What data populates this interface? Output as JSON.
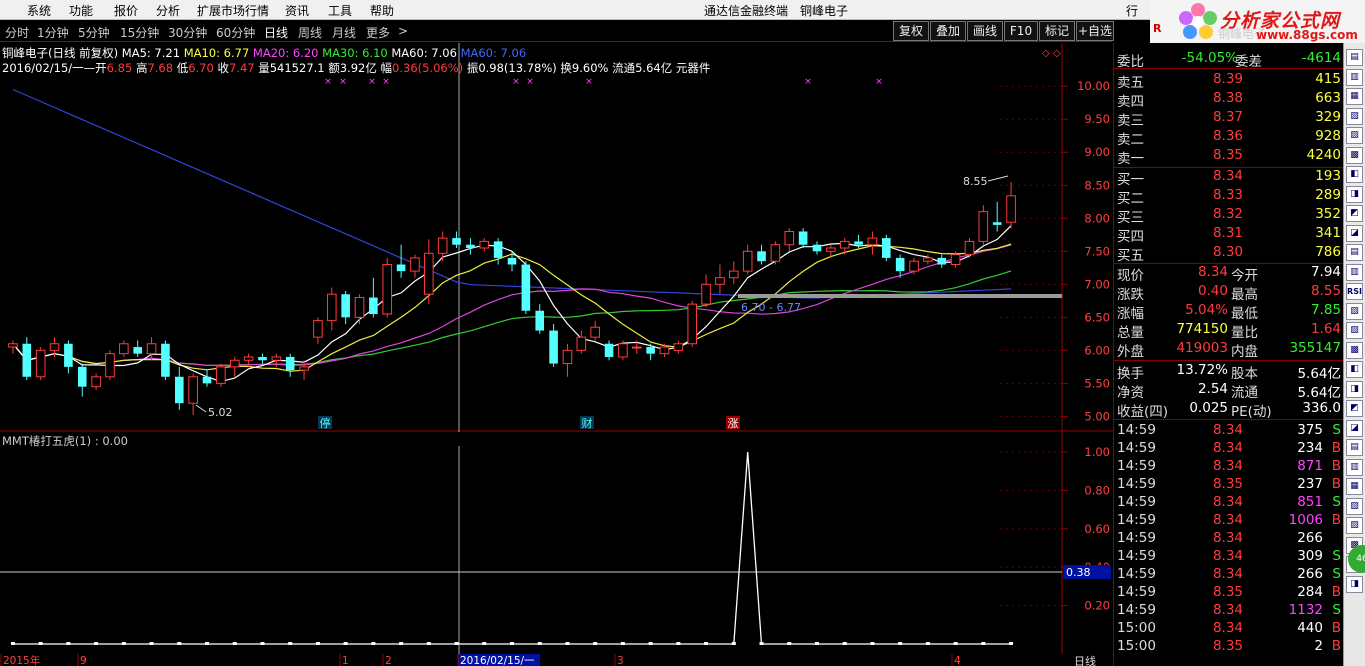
{
  "menu": {
    "items": [
      "系统",
      "功能",
      "报价",
      "分析",
      "扩展市场行情",
      "资讯",
      "工具",
      "帮助"
    ],
    "title_product": "通达信金融终端",
    "title_stock": "铜峰电子",
    "right_item": "行"
  },
  "logo": {
    "title": "分析家公式网",
    "url": "www.88gs.com",
    "faint_text": "铜峰电子",
    "red_letter": "R"
  },
  "toolbar": {
    "periods": [
      "分时",
      "1分钟",
      "5分钟",
      "15分钟",
      "30分钟",
      "60分钟",
      "日线",
      "周线",
      "月线",
      "更多"
    ],
    "more_arrow": ">",
    "active": "日线",
    "buttons": [
      "复权",
      "叠加",
      "画线",
      "F10",
      "标记",
      "+自选"
    ]
  },
  "chart_header": {
    "name": "铜峰电子(日线 前复权)",
    "ma": [
      {
        "label": "MA5: 7.21",
        "color": "#ffffff"
      },
      {
        "label": "MA10: 6.77",
        "color": "#ffff40"
      },
      {
        "label": "MA20: 6.20",
        "color": "#ff44ff"
      },
      {
        "label": "MA30: 6.10",
        "color": "#33ee33"
      },
      {
        "label": "MA60: 7.06",
        "color": "#ffffff"
      },
      {
        "label": "MA60: 7.06",
        "color": "#4466ff"
      }
    ],
    "date": "2016/02/15/一",
    "open_label": "开",
    "open": "6.85",
    "high_label": "高",
    "high": "7.68",
    "low_label": "低",
    "low": "6.70",
    "close_label": "收",
    "close": "7.47",
    "vol_label": "量",
    "vol": "541527.1",
    "amt_label": "额",
    "amt": "3.92亿",
    "chg_label": "幅",
    "chg": "0.36(5.06%)",
    "amp_label": "振",
    "amp": "0.98(13.78%)",
    "turn_label": "换",
    "turn": "9.60%",
    "float_label": "流通",
    "float": "5.64亿",
    "industry": "元器件"
  },
  "price_axis": [
    "10.00",
    "9.50",
    "9.00",
    "8.50",
    "8.00",
    "7.50",
    "7.00",
    "6.50",
    "6.00",
    "5.50",
    "5.00"
  ],
  "annotations": {
    "high_label": "8.55",
    "low_label": "5.02",
    "line_label": "6.70 - 6.77",
    "tags": [
      "停",
      "财",
      "涨"
    ]
  },
  "indicator": {
    "title": "MMT椿打五虎(1) : 0.00",
    "axis": [
      "1.00",
      "0.80",
      "0.60",
      "0.40",
      "0.20"
    ],
    "cursor_value": "0.38"
  },
  "bottom_axis": {
    "labels": [
      "2015年",
      "9",
      "1",
      "2",
      "2016/02/15/一",
      "3",
      "4"
    ],
    "period": "日线"
  },
  "quote": {
    "weibi": {
      "label": "委比",
      "value": "-54.05%",
      "label2": "委差",
      "value2": "-4614"
    },
    "asks": [
      {
        "label": "卖五",
        "price": "8.39",
        "vol": "415"
      },
      {
        "label": "卖四",
        "price": "8.38",
        "vol": "663"
      },
      {
        "label": "卖三",
        "price": "8.37",
        "vol": "329"
      },
      {
        "label": "卖二",
        "price": "8.36",
        "vol": "928"
      },
      {
        "label": "卖一",
        "price": "8.35",
        "vol": "4240"
      }
    ],
    "bids": [
      {
        "label": "买一",
        "price": "8.34",
        "vol": "193"
      },
      {
        "label": "买二",
        "price": "8.33",
        "vol": "289"
      },
      {
        "label": "买三",
        "price": "8.32",
        "vol": "352"
      },
      {
        "label": "买四",
        "price": "8.31",
        "vol": "341"
      },
      {
        "label": "买五",
        "price": "8.30",
        "vol": "786"
      }
    ],
    "stats": [
      {
        "l1": "现价",
        "v1": "8.34",
        "c1": "red",
        "l2": "今开",
        "v2": "7.94",
        "c2": "white"
      },
      {
        "l1": "涨跌",
        "v1": "0.40",
        "c1": "red",
        "l2": "最高",
        "v2": "8.55",
        "c2": "red"
      },
      {
        "l1": "涨幅",
        "v1": "5.04%",
        "c1": "red",
        "l2": "最低",
        "v2": "7.85",
        "c2": "green"
      },
      {
        "l1": "总量",
        "v1": "774150",
        "c1": "yellow",
        "l2": "量比",
        "v2": "1.64",
        "c2": "red"
      },
      {
        "l1": "外盘",
        "v1": "419003",
        "c1": "red",
        "l2": "内盘",
        "v2": "355147",
        "c2": "green"
      }
    ],
    "stats2": [
      {
        "l1": "换手",
        "v1": "13.72%",
        "l2": "股本",
        "v2": "5.64亿"
      },
      {
        "l1": "净资",
        "v1": "2.54",
        "l2": "流通",
        "v2": "5.64亿"
      },
      {
        "l1": "收益(四)",
        "v1": "0.025",
        "l2": "PE(动)",
        "v2": "336.0"
      }
    ],
    "ticks": [
      {
        "t": "14:59",
        "p": "8.34",
        "v": "375",
        "d": "S",
        "vc": "white"
      },
      {
        "t": "14:59",
        "p": "8.34",
        "v": "234",
        "d": "B",
        "vc": "white"
      },
      {
        "t": "14:59",
        "p": "8.34",
        "v": "871",
        "d": "B",
        "vc": "magenta"
      },
      {
        "t": "14:59",
        "p": "8.35",
        "v": "237",
        "d": "B",
        "vc": "white"
      },
      {
        "t": "14:59",
        "p": "8.34",
        "v": "851",
        "d": "S",
        "vc": "magenta"
      },
      {
        "t": "14:59",
        "p": "8.34",
        "v": "1006",
        "d": "B",
        "vc": "magenta"
      },
      {
        "t": "14:59",
        "p": "8.34",
        "v": "266",
        "d": "",
        "vc": "white"
      },
      {
        "t": "14:59",
        "p": "8.34",
        "v": "309",
        "d": "S",
        "vc": "white"
      },
      {
        "t": "14:59",
        "p": "8.34",
        "v": "266",
        "d": "S",
        "vc": "white"
      },
      {
        "t": "14:59",
        "p": "8.35",
        "v": "284",
        "d": "B",
        "vc": "white"
      },
      {
        "t": "14:59",
        "p": "8.34",
        "v": "1132",
        "d": "S",
        "vc": "magenta"
      },
      {
        "t": "15:00",
        "p": "8.34",
        "v": "440",
        "d": "B",
        "vc": "white"
      },
      {
        "t": "15:00",
        "p": "8.35",
        "v": "2",
        "d": "B",
        "vc": "white"
      }
    ]
  },
  "sidebar": {
    "items": [
      "icon1",
      "icon2",
      "icon3",
      "icon4",
      "icon5",
      "icon6",
      "icon7",
      "icon8",
      "icon9",
      "icon10",
      "icon11",
      "icon12",
      "RSI",
      "icon14",
      "icon15",
      "icon16",
      "icon17",
      "icon18",
      "icon19",
      "icon20",
      "icon21",
      "icon22",
      "icon23",
      "icon24",
      "icon25",
      "icon26",
      "icon27",
      "icon28"
    ],
    "badge": "46"
  },
  "chart_data": {
    "type": "candlestick",
    "ylim": [
      4.9,
      10.2
    ],
    "candles": [
      [
        6.05,
        6.15,
        5.95,
        6.1
      ],
      [
        6.1,
        6.2,
        5.55,
        5.6
      ],
      [
        5.6,
        6.05,
        5.55,
        6.0
      ],
      [
        6.0,
        6.2,
        5.9,
        6.1
      ],
      [
        6.1,
        6.15,
        5.65,
        5.75
      ],
      [
        5.75,
        5.8,
        5.3,
        5.45
      ],
      [
        5.45,
        5.65,
        5.4,
        5.6
      ],
      [
        5.6,
        6.0,
        5.55,
        5.95
      ],
      [
        5.95,
        6.15,
        5.9,
        6.1
      ],
      [
        6.05,
        6.15,
        5.9,
        5.95
      ],
      [
        5.95,
        6.2,
        5.85,
        6.1
      ],
      [
        6.1,
        6.15,
        5.55,
        5.6
      ],
      [
        5.6,
        5.75,
        5.1,
        5.2
      ],
      [
        5.2,
        5.65,
        5.02,
        5.6
      ],
      [
        5.6,
        5.7,
        5.45,
        5.5
      ],
      [
        5.5,
        5.8,
        5.45,
        5.75
      ],
      [
        5.75,
        5.9,
        5.6,
        5.85
      ],
      [
        5.85,
        5.95,
        5.75,
        5.9
      ],
      [
        5.9,
        5.95,
        5.8,
        5.85
      ],
      [
        5.85,
        5.95,
        5.75,
        5.9
      ],
      [
        5.9,
        5.95,
        5.6,
        5.7
      ],
      [
        5.7,
        5.85,
        5.55,
        5.75
      ],
      [
        6.2,
        6.5,
        6.1,
        6.45
      ],
      [
        6.45,
        6.95,
        6.3,
        6.85
      ],
      [
        6.85,
        6.9,
        6.4,
        6.5
      ],
      [
        6.5,
        6.85,
        6.4,
        6.8
      ],
      [
        6.8,
        7.1,
        6.5,
        6.55
      ],
      [
        6.55,
        7.4,
        6.5,
        7.3
      ],
      [
        7.3,
        7.6,
        7.1,
        7.2
      ],
      [
        7.2,
        7.45,
        7.1,
        7.4
      ],
      [
        6.85,
        7.68,
        6.7,
        7.47
      ],
      [
        7.47,
        7.8,
        7.35,
        7.7
      ],
      [
        7.7,
        7.8,
        7.55,
        7.6
      ],
      [
        7.6,
        7.7,
        7.45,
        7.55
      ],
      [
        7.55,
        7.7,
        7.5,
        7.65
      ],
      [
        7.65,
        7.7,
        7.3,
        7.4
      ],
      [
        7.4,
        7.5,
        7.2,
        7.3
      ],
      [
        7.3,
        7.35,
        6.55,
        6.6
      ],
      [
        6.6,
        6.7,
        6.25,
        6.3
      ],
      [
        6.3,
        6.4,
        5.75,
        5.8
      ],
      [
        5.8,
        6.1,
        5.6,
        6.0
      ],
      [
        6.0,
        6.3,
        5.95,
        6.2
      ],
      [
        6.2,
        6.45,
        6.15,
        6.35
      ],
      [
        6.1,
        6.15,
        5.85,
        5.9
      ],
      [
        5.9,
        6.15,
        5.85,
        6.1
      ],
      [
        6.05,
        6.15,
        5.95,
        6.05
      ],
      [
        6.05,
        6.1,
        5.85,
        5.95
      ],
      [
        5.95,
        6.1,
        5.9,
        6.05
      ],
      [
        6.0,
        6.15,
        5.95,
        6.1
      ],
      [
        6.1,
        6.75,
        6.05,
        6.7
      ],
      [
        6.7,
        7.15,
        6.65,
        7.0
      ],
      [
        7.0,
        7.3,
        6.85,
        7.1
      ],
      [
        7.1,
        7.35,
        7.0,
        7.2
      ],
      [
        7.2,
        7.6,
        7.15,
        7.5
      ],
      [
        7.5,
        7.6,
        7.3,
        7.35
      ],
      [
        7.35,
        7.65,
        7.3,
        7.6
      ],
      [
        7.6,
        7.85,
        7.5,
        7.8
      ],
      [
        7.8,
        7.85,
        7.55,
        7.6
      ],
      [
        7.6,
        7.65,
        7.45,
        7.5
      ],
      [
        7.5,
        7.6,
        7.4,
        7.55
      ],
      [
        7.55,
        7.7,
        7.45,
        7.65
      ],
      [
        7.65,
        7.75,
        7.55,
        7.6
      ],
      [
        7.6,
        7.8,
        7.45,
        7.7
      ],
      [
        7.7,
        7.75,
        7.35,
        7.4
      ],
      [
        7.4,
        7.45,
        7.1,
        7.2
      ],
      [
        7.2,
        7.4,
        7.15,
        7.35
      ],
      [
        7.35,
        7.45,
        7.3,
        7.4
      ],
      [
        7.4,
        7.45,
        7.25,
        7.3
      ],
      [
        7.3,
        7.5,
        7.25,
        7.45
      ],
      [
        7.45,
        7.7,
        7.4,
        7.65
      ],
      [
        7.65,
        8.2,
        7.6,
        8.1
      ],
      [
        7.94,
        8.25,
        7.8,
        7.9
      ],
      [
        7.94,
        8.55,
        7.85,
        8.34
      ]
    ],
    "indicator_series": [
      0,
      0,
      0,
      0,
      0,
      0,
      0,
      0,
      0,
      0,
      0,
      0,
      0,
      0,
      0,
      0,
      0,
      0,
      0,
      0,
      0,
      0,
      0,
      0,
      0,
      0,
      0,
      0,
      0,
      0,
      0,
      0,
      0,
      0,
      0,
      0,
      0,
      0,
      0,
      0,
      0,
      0,
      0,
      0,
      0,
      0,
      0,
      0,
      0,
      0,
      0,
      0,
      0,
      1,
      0,
      0,
      0,
      0,
      0,
      0,
      0,
      0,
      0,
      0,
      0,
      0,
      0,
      0,
      0,
      0,
      0,
      0,
      0
    ]
  }
}
